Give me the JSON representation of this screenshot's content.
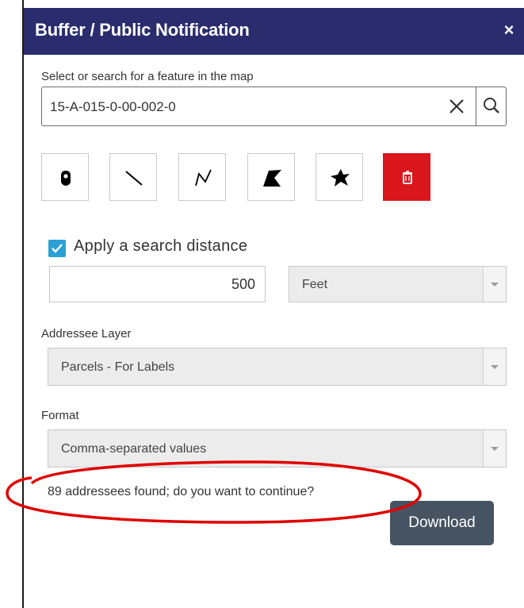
{
  "panel": {
    "title": "Buffer / Public Notification",
    "close_label": "×"
  },
  "search": {
    "label": "Select or search for a feature in the map",
    "value": "15-A-015-0-00-002-0"
  },
  "tools": [
    {
      "name": "point-tool",
      "icon": "map-pin-icon"
    },
    {
      "name": "line-tool",
      "icon": "line-icon"
    },
    {
      "name": "polyline-tool",
      "icon": "polyline-icon"
    },
    {
      "name": "polygon-tool",
      "icon": "polygon-icon"
    },
    {
      "name": "freehand-polygon-tool",
      "icon": "freehand-shape-icon"
    },
    {
      "name": "clear-graphics-tool",
      "icon": "trash-icon"
    }
  ],
  "distance": {
    "checkbox_label": "Apply a search distance",
    "checked": true,
    "value": "500",
    "unit": "Feet"
  },
  "addressee_layer": {
    "label": "Addressee Layer",
    "selected": "Parcels - For Labels"
  },
  "format": {
    "label": "Format",
    "selected": "Comma-separated values"
  },
  "result": {
    "message": "89 addressees found; do you want to continue?"
  },
  "actions": {
    "download_label": "Download"
  },
  "colors": {
    "header_bg": "#2a2c6e",
    "checkbox": "#2aa0d4",
    "trash_button": "#d9171d",
    "download_button": "#465362",
    "annotation_ellipse": "#e00000"
  }
}
